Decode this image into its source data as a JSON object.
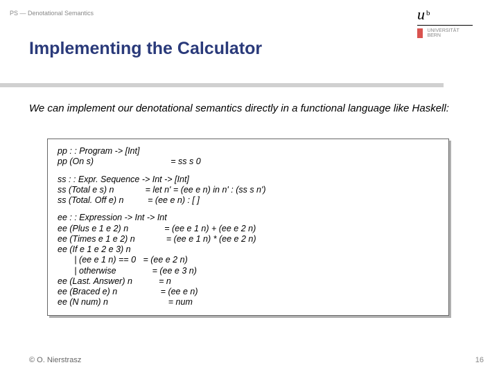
{
  "header": {
    "label": "PS — Denotational Semantics"
  },
  "logo": {
    "u": "u",
    "b": "b",
    "line1": "UNIVERSITÄT",
    "line2": "BERN"
  },
  "title": "Implementing the Calculator",
  "intro": "We can implement our denotational semantics directly in a functional language like Haskell:",
  "code": {
    "block1": {
      "l1": "pp : : Program -> [Int]",
      "l2": "pp (On s)                                = ss s 0"
    },
    "block2": {
      "l1": "ss : : Expr. Sequence -> Int -> [Int]",
      "l2": "ss (Total e s) n             = let n' = (ee e n) in n' : (ss s n')",
      "l3": "ss (Total. Off e) n          = (ee e n) : [ ]"
    },
    "block3": {
      "l1": "ee : : Expression -> Int -> Int",
      "l2": "ee (Plus e 1 e 2) n               = (ee e 1 n) + (ee e 2 n)",
      "l3": "ee (Times e 1 e 2) n             = (ee e 1 n) * (ee e 2 n)",
      "l4": "ee (If e 1 e 2 e 3) n",
      "l5": "       | (ee e 1 n) == 0   = (ee e 2 n)",
      "l6": "       | otherwise               = (ee e 3 n)",
      "l7": "ee (Last. Answer) n           = n",
      "l8": "ee (Braced e) n                  = (ee e n)",
      "l9": "ee (N num) n                         = num"
    }
  },
  "footer": {
    "copyright": "© O. Nierstrasz",
    "page": "16"
  }
}
